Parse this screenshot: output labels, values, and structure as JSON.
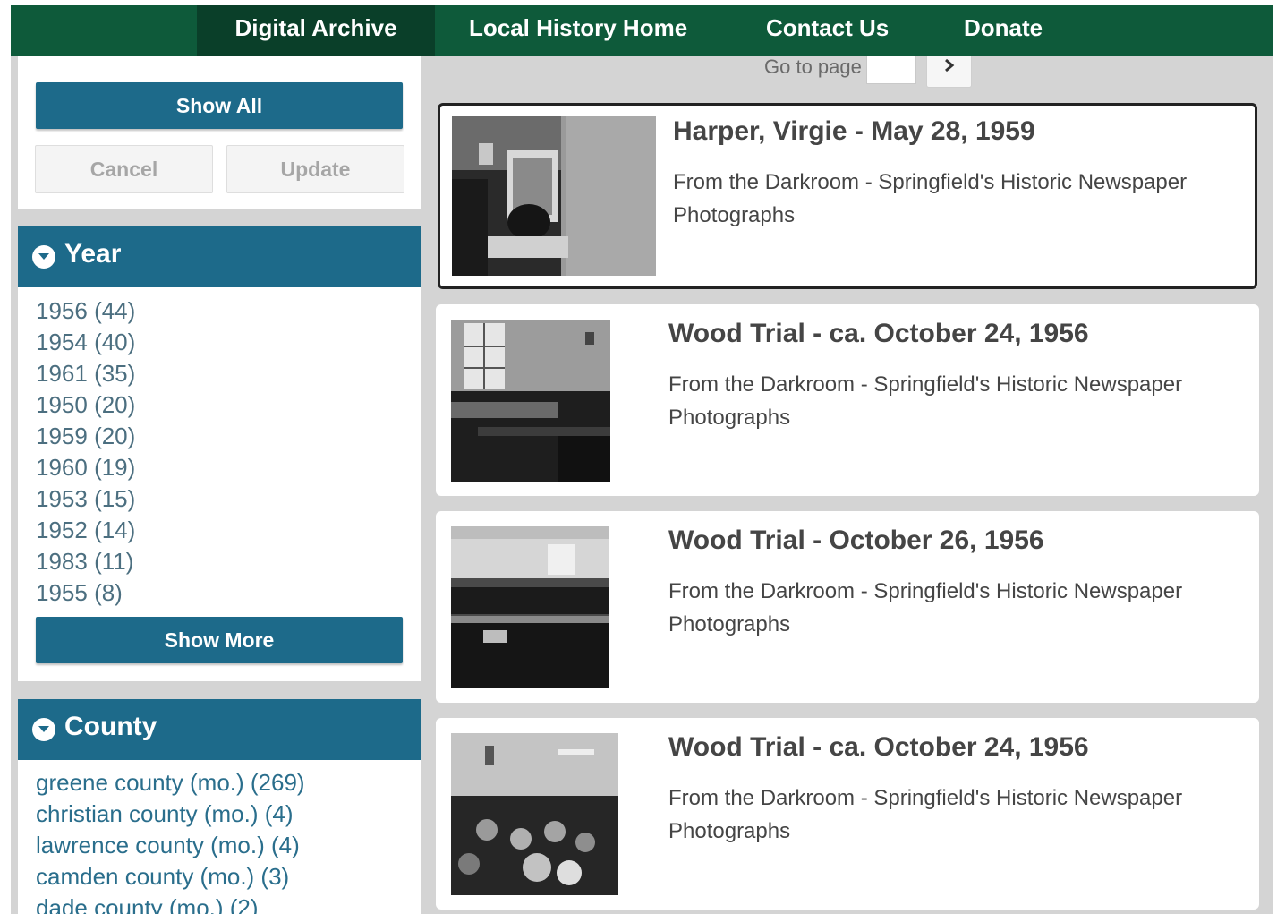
{
  "nav": {
    "items": [
      "Digital Archive",
      "Local History Home",
      "Contact Us",
      "Donate"
    ],
    "active": "Digital Archive",
    "color": "#0e5a3a"
  },
  "pager": {
    "label": "Go to page",
    "value": ""
  },
  "actions": {
    "show_all": "Show All",
    "cancel": "Cancel",
    "update": "Update"
  },
  "year": {
    "title": "Year",
    "items": [
      "1956 (44)",
      "1954 (40)",
      "1961 (35)",
      "1950 (20)",
      "1959 (20)",
      "1960 (19)",
      "1953 (15)",
      "1952 (14)",
      "1983 (11)",
      "1955 (8)"
    ],
    "show_more": "Show More"
  },
  "county": {
    "title": "County",
    "items": [
      "greene county (mo.) (269)",
      "christian county (mo.) (4)",
      "lawrence county (mo.) (4)",
      "camden county (mo.) (3)",
      "dade county (mo.) (2)"
    ]
  },
  "results": [
    {
      "title": "Harper, Virgie - May 28, 1959",
      "collection": "From the Darkroom - Springfield's Historic Newspaper Photographs"
    },
    {
      "title": "Wood Trial - ca. October 24, 1956",
      "collection": "From the Darkroom - Springfield's Historic Newspaper Photographs"
    },
    {
      "title": "Wood Trial - October 26, 1956",
      "collection": "From the Darkroom - Springfield's Historic Newspaper Photographs"
    },
    {
      "title": "Wood Trial - ca. October 24, 1956",
      "collection": "From the Darkroom - Springfield's Historic Newspaper Photographs"
    }
  ],
  "colors": {
    "panel_header": "#1d6a8a",
    "background": "#d4d4d4"
  },
  "icons": {
    "facet_toggle": "chevron-down-circle-icon",
    "next_page": "chevron-right-icon"
  }
}
